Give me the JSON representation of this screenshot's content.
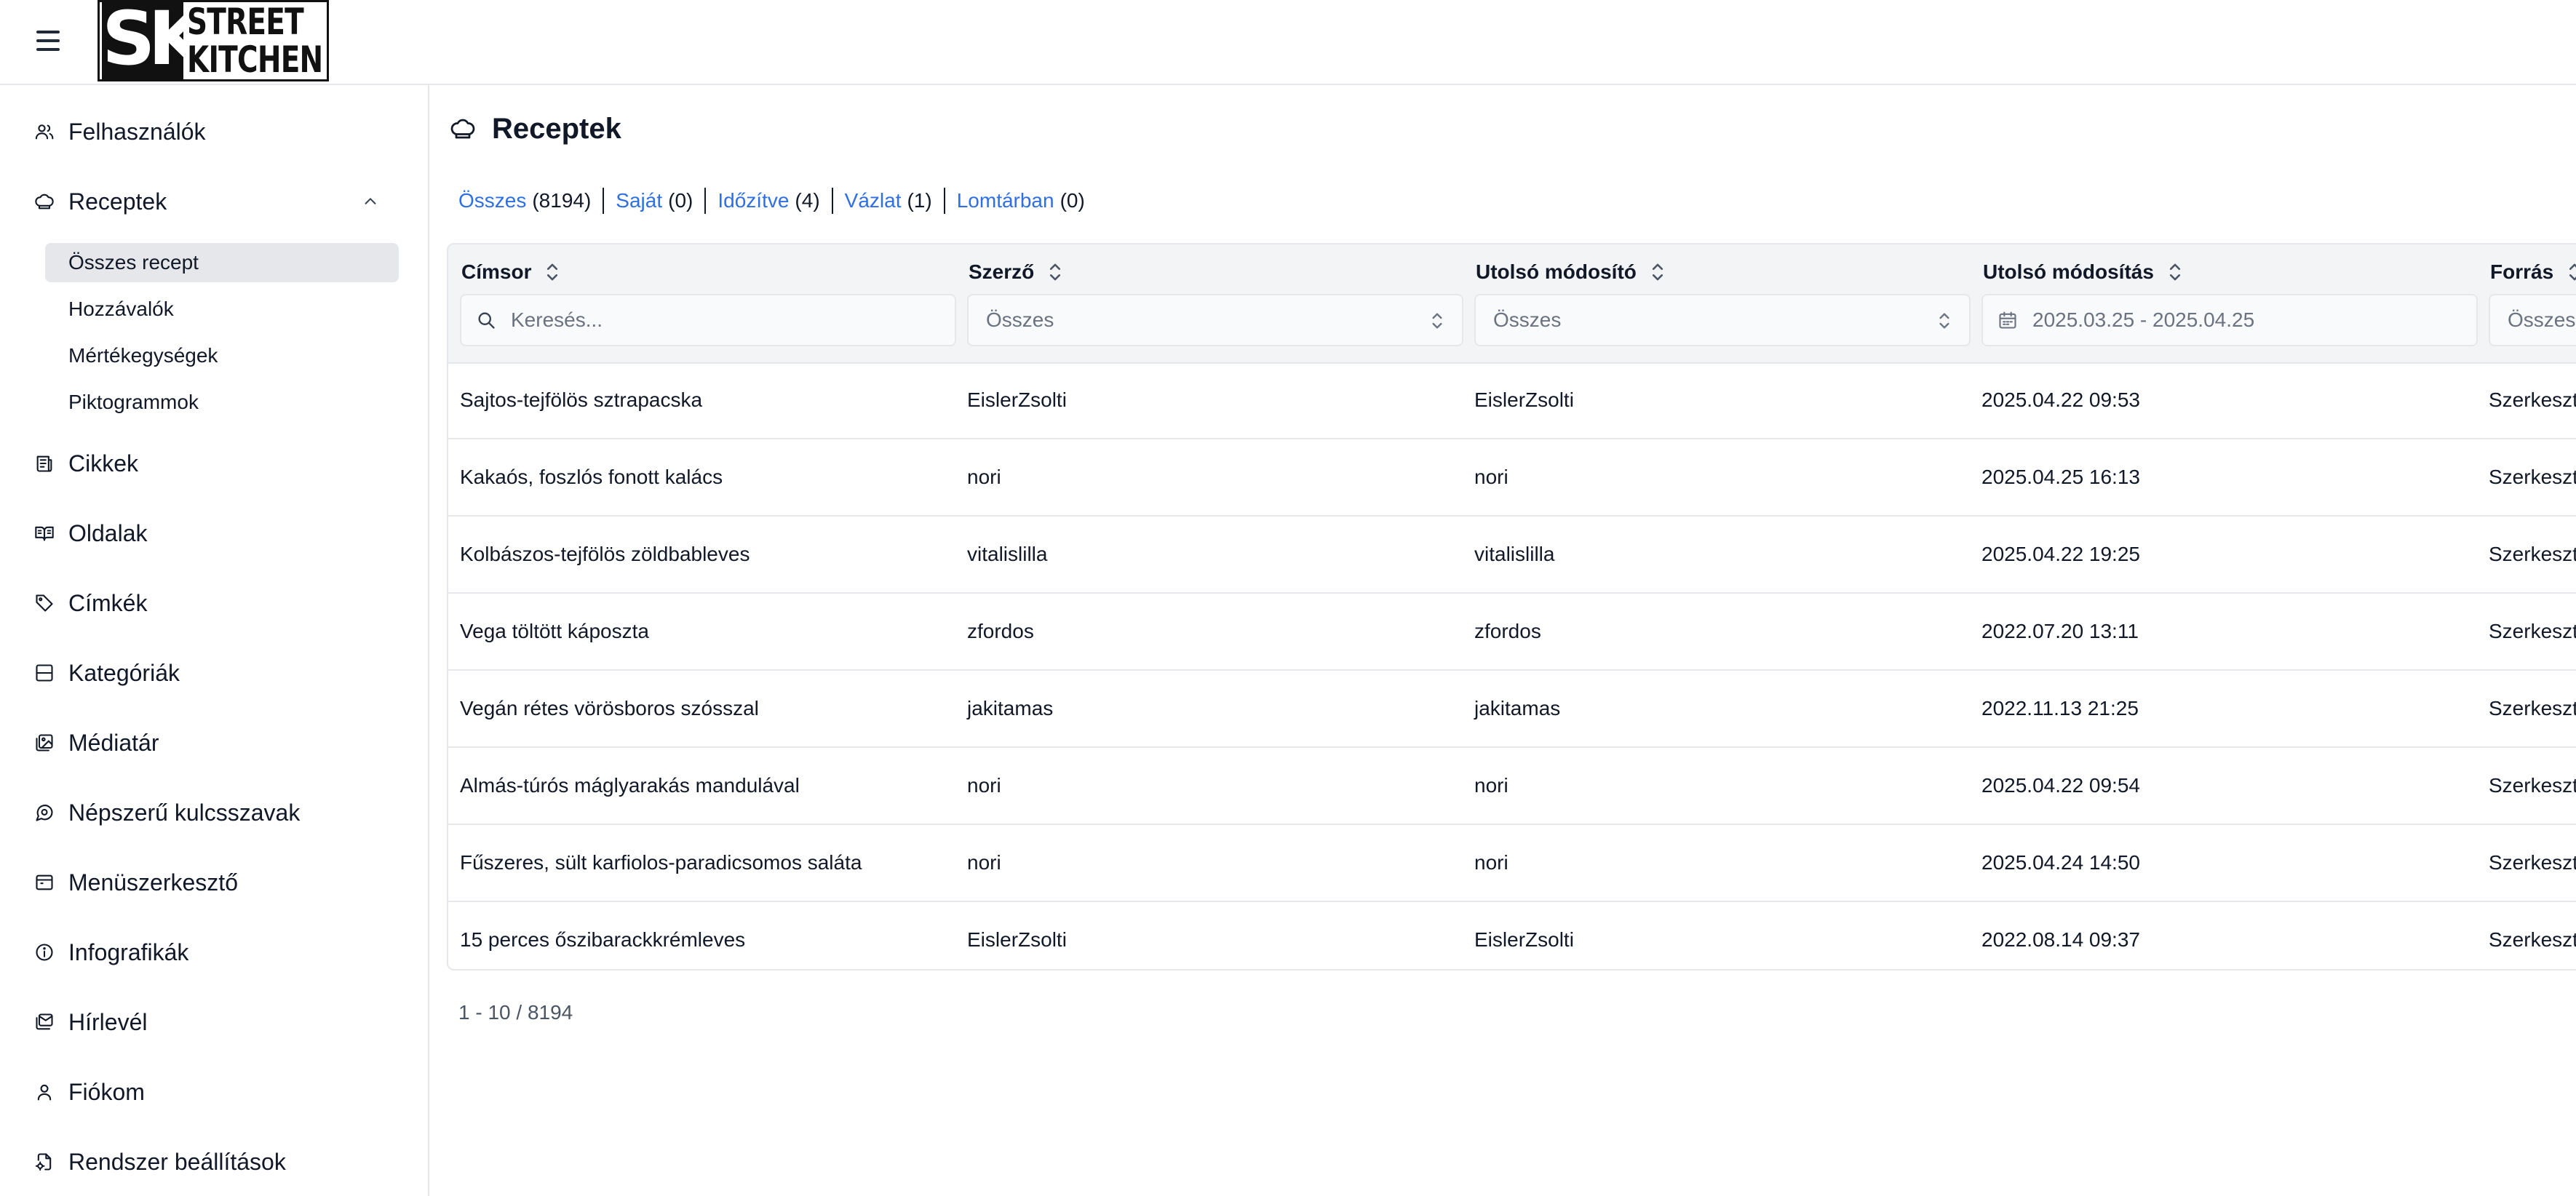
{
  "header": {
    "logo": {
      "mark": "SK",
      "line1": "STREET",
      "line2": "KITCHEN"
    }
  },
  "sidebar": {
    "items": [
      {
        "label": "Felhasználók",
        "icon": "users-icon"
      },
      {
        "label": "Receptek",
        "icon": "chef-hat-icon",
        "expanded": true
      },
      {
        "label": "Cikkek",
        "icon": "newspaper-icon"
      },
      {
        "label": "Oldalak",
        "icon": "book-open-icon"
      },
      {
        "label": "Címkék",
        "icon": "tag-icon"
      },
      {
        "label": "Kategóriák",
        "icon": "layout-icon"
      },
      {
        "label": "Médiatár",
        "icon": "images-icon"
      },
      {
        "label": "Népszerű kulcsszavak",
        "icon": "chat-icon"
      },
      {
        "label": "Menüszerkesztő",
        "icon": "menu-panel-icon"
      },
      {
        "label": "Infografikák",
        "icon": "info-icon"
      },
      {
        "label": "Hírlevél",
        "icon": "mail-stack-icon"
      },
      {
        "label": "Fiókom",
        "icon": "user-icon"
      },
      {
        "label": "Rendszer beállítások",
        "icon": "settings-file-icon"
      }
    ],
    "subitems": [
      {
        "label": "Összes recept",
        "active": true
      },
      {
        "label": "Hozzávalók"
      },
      {
        "label": "Mértékegységek"
      },
      {
        "label": "Piktogrammok"
      }
    ]
  },
  "main": {
    "title": "Receptek",
    "title_icon": "chef-hat-icon",
    "filters": [
      {
        "label": "Összes",
        "count": "(8194)"
      },
      {
        "label": "Saját",
        "count": "(0)"
      },
      {
        "label": "Időzítve",
        "count": "(4)"
      },
      {
        "label": "Vázlat",
        "count": "(1)"
      },
      {
        "label": "Lomtárban",
        "count": "(0)"
      }
    ],
    "table": {
      "columns": [
        {
          "label": "Címsor",
          "filter": "Keresés...",
          "filter_type": "search"
        },
        {
          "label": "Szerző",
          "filter": "Összes",
          "filter_type": "select"
        },
        {
          "label": "Utolsó módosító",
          "filter": "Összes",
          "filter_type": "select"
        },
        {
          "label": "Utolsó módosítás",
          "filter": "2025.03.25 - 2025.04.25",
          "filter_type": "date"
        },
        {
          "label": "Forrás",
          "filter": "Összes",
          "filter_type": "select"
        }
      ],
      "rows": [
        [
          "Sajtos-tejfölös sztrapacska",
          "EislerZsolti",
          "EislerZsolti",
          "2025.04.22 09:53",
          "Szerkeszt"
        ],
        [
          "Kakaós, foszlós fonott kalács",
          "nori",
          "nori",
          "2025.04.25 16:13",
          "Szerkeszt"
        ],
        [
          "Kolbászos-tejfölös zöldbableves",
          "vitalislilla",
          "vitalislilla",
          "2025.04.22 19:25",
          "Szerkeszt"
        ],
        [
          "Vega töltött káposzta",
          "zfordos",
          "zfordos",
          "2022.07.20 13:11",
          "Szerkeszt"
        ],
        [
          "Vegán rétes vörösboros szósszal",
          "jakitamas",
          "jakitamas",
          "2022.11.13 21:25",
          "Szerkeszt"
        ],
        [
          "Almás-túrós máglyarakás mandulával",
          "nori",
          "nori",
          "2025.04.22 09:54",
          "Szerkeszt"
        ],
        [
          "Fűszeres, sült karfiolos-paradicsomos saláta",
          "nori",
          "nori",
          "2025.04.24 14:50",
          "Szerkeszt"
        ],
        [
          "15 perces őszibarackkrémleves",
          "EislerZsolti",
          "EislerZsolti",
          "2022.08.14 09:37",
          "Szerkeszt"
        ]
      ]
    },
    "pagination": "1 - 10 / 8194"
  }
}
